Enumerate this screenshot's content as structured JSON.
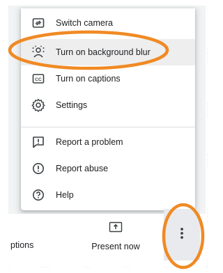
{
  "menu": {
    "items": [
      {
        "label": "Switch camera",
        "icon": "switch-camera-icon"
      },
      {
        "label": "Turn on background blur",
        "icon": "background-blur-icon"
      },
      {
        "label": "Turn on captions",
        "icon": "captions-icon"
      },
      {
        "label": "Settings",
        "icon": "gear-icon"
      },
      {
        "label": "Report a problem",
        "icon": "report-problem-icon"
      },
      {
        "label": "Report abuse",
        "icon": "report-abuse-icon"
      },
      {
        "label": "Help",
        "icon": "help-icon"
      }
    ]
  },
  "bottom_bar": {
    "captions_label": "ptions",
    "present_label": "Present now",
    "more_icon": "more-vert-icon"
  },
  "colors": {
    "annotation": "#f08a24",
    "icon": "#3c4043",
    "highlight": "#eeeeee"
  }
}
